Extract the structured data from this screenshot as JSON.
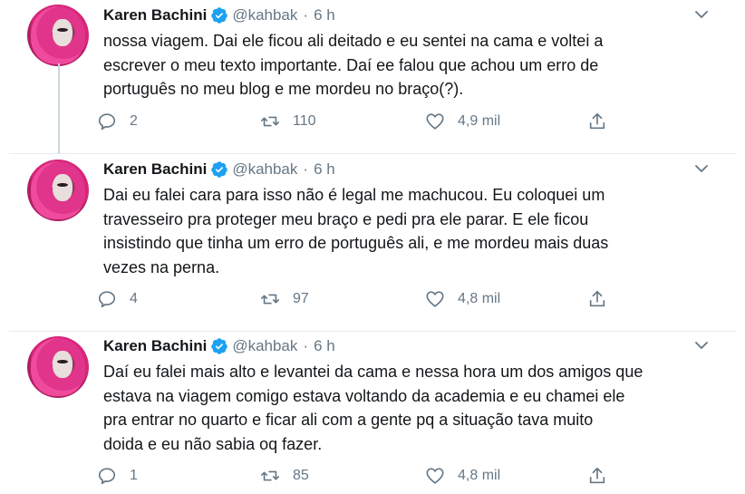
{
  "tweets": [
    {
      "author_name": "Karen Bachini",
      "handle": "@kahbak",
      "separator": "·",
      "time": "6 h",
      "lines": [
        "nossa viagem. Dai ele ficou ali deitado e eu sentei na cama e voltei a",
        "escrever o meu texto importante. Daí ee falou que achou um erro de",
        "português no meu blog e me mordeu no braço(?)."
      ],
      "replies": "2",
      "retweets": "110",
      "likes": "4,9 mil"
    },
    {
      "author_name": "Karen Bachini",
      "handle": "@kahbak",
      "separator": "·",
      "time": "6 h",
      "lines": [
        "Dai eu falei cara para isso não é legal me machucou. Eu coloquei um",
        "travesseiro pra proteger meu braço e pedi pra ele parar. E ele ficou",
        "insistindo que tinha um erro de português ali, e me mordeu mais duas",
        "vezes na perna."
      ],
      "replies": "4",
      "retweets": "97",
      "likes": "4,8 mil"
    },
    {
      "author_name": "Karen Bachini",
      "handle": "@kahbak",
      "separator": "·",
      "time": "6 h",
      "lines": [
        "Daí eu falei mais alto e levantei da cama e nessa hora um dos amigos que",
        "estava na viagem comigo estava voltando da academia e eu chamei ele",
        "pra entrar no quarto e ficar ali com a gente pq a situação tava muito",
        "doida e eu não sabia oq fazer."
      ],
      "replies": "1",
      "retweets": "85",
      "likes": "4,8 mil"
    }
  ],
  "icons": {
    "verified": "verified-badge-icon",
    "more": "chevron-down-icon",
    "reply": "reply-icon",
    "retweet": "retweet-icon",
    "like": "heart-icon",
    "share": "share-icon"
  },
  "colors": {
    "text": "#14171a",
    "secondary": "#657786",
    "verified_blue": "#1da1f2",
    "divider": "#e6ecf0",
    "thread_line": "#ccd6dd"
  }
}
